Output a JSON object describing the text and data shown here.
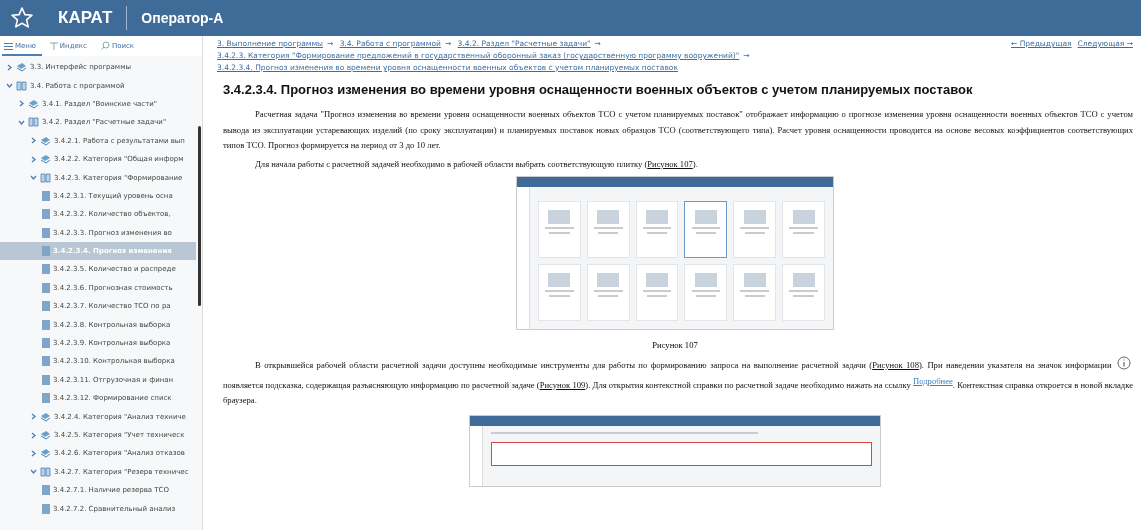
{
  "header": {
    "app_name": "КАРАТ",
    "user": "Оператор-А"
  },
  "sidebar": {
    "tabs": [
      {
        "label": "Меню",
        "kind": "menu",
        "selected": true
      },
      {
        "label": "Индекс",
        "kind": "index",
        "selected": false
      },
      {
        "label": "Поиск",
        "kind": "search",
        "selected": false
      }
    ],
    "tree": [
      {
        "label": "3.3. Интерфейс программы",
        "expanded": false,
        "selected": false,
        "kind": "section"
      },
      {
        "label": "3.4. Работа с программой",
        "expanded": true,
        "selected": false,
        "kind": "section",
        "children": [
          {
            "label": "3.4.1. Раздел \"Воинские части\"",
            "expanded": false,
            "selected": false,
            "kind": "section"
          },
          {
            "label": "3.4.2. Раздел \"Расчетные задачи\"",
            "expanded": true,
            "selected": false,
            "kind": "section",
            "children": [
              {
                "label": "3.4.2.1. Работа с результатами вып",
                "expanded": false,
                "selected": false,
                "kind": "section"
              },
              {
                "label": "3.4.2.2. Категория \"Общая информ",
                "expanded": false,
                "selected": false,
                "kind": "section"
              },
              {
                "label": "3.4.2.3. Категория \"Формирование",
                "expanded": true,
                "selected": false,
                "kind": "section",
                "children": [
                  {
                    "label": "3.4.2.3.1. Текущий уровень осна",
                    "selected": false,
                    "kind": "page"
                  },
                  {
                    "label": "3.4.2.3.2. Количество объектов,",
                    "selected": false,
                    "kind": "page"
                  },
                  {
                    "label": "3.4.2.3.3. Прогноз изменения во",
                    "selected": false,
                    "kind": "page"
                  },
                  {
                    "label": "3.4.2.3.4. Прогноз изменения",
                    "selected": true,
                    "kind": "page"
                  },
                  {
                    "label": "3.4.2.3.5. Количество и распреде",
                    "selected": false,
                    "kind": "page"
                  },
                  {
                    "label": "3.4.2.3.6. Прогнозная стоимость",
                    "selected": false,
                    "kind": "page"
                  },
                  {
                    "label": "3.4.2.3.7. Количество ТСО по ра",
                    "selected": false,
                    "kind": "page"
                  },
                  {
                    "label": "3.4.2.3.8. Контрольная выборка",
                    "selected": false,
                    "kind": "page"
                  },
                  {
                    "label": "3.4.2.3.9. Контрольная выборка",
                    "selected": false,
                    "kind": "page"
                  },
                  {
                    "label": "3.4.2.3.10. Контрольная выборка",
                    "selected": false,
                    "kind": "page"
                  },
                  {
                    "label": "3.4.2.3.11. Отгрузочная и финан",
                    "selected": false,
                    "kind": "page"
                  },
                  {
                    "label": "3.4.2.3.12. Формирование списк",
                    "selected": false,
                    "kind": "page"
                  }
                ]
              },
              {
                "label": "3.4.2.4. Категория \"Анализ техниче",
                "expanded": false,
                "selected": false,
                "kind": "section"
              },
              {
                "label": "3.4.2.5. Категория \"Учет техническ",
                "expanded": false,
                "selected": false,
                "kind": "section"
              },
              {
                "label": "3.4.2.6. Категория \"Анализ отказов",
                "expanded": false,
                "selected": false,
                "kind": "section"
              },
              {
                "label": "3.4.2.7. Категория \"Резерв техничес",
                "expanded": true,
                "selected": false,
                "kind": "section",
                "children": [
                  {
                    "label": "3.4.2.7.1. Наличие резерва ТСО",
                    "selected": false,
                    "kind": "page"
                  },
                  {
                    "label": "3.4.2.7.2. Сравнительный анализ",
                    "selected": false,
                    "kind": "page"
                  }
                ]
              }
            ]
          }
        ]
      }
    ]
  },
  "breadcrumb": {
    "items": [
      "3. Выполнение программы",
      "3.4. Работа с программой",
      "3.4.2. Раздел \"Расчетные задачи\"",
      "3.4.2.3. Категория \"Формирование предложений в государственный оборонный заказ (государственную программу вооружений)\"",
      "3.4.2.3.4. Прогноз изменения во времени уровня оснащенности военных объектов с учетом планируемых поставок"
    ],
    "separator": "→",
    "previous": "← Предыдущая",
    "next": "Следующая →"
  },
  "article": {
    "title": "3.4.2.3.4. Прогноз изменения во времени уровня оснащенности военных объектов с учетом планируемых поставок",
    "blocks": [
      {
        "kind": "paragraph",
        "segments": [
          {
            "kind": "text",
            "text": "Расчетная задача \"Прогноз изменения во времени уровня оснащенности военных объектов ТСО с учетом планируемых поставок\" отображает информацию о прогнозе изменения уровня оснащенности военных объектов ТСО с учетом вывода из эксплуатации устаревающих изделий (по сроку эксплуатации) и планируемых поставок новых образцов ТСО (соответствующего типа). Расчет уровня оснащенности проводится на основе весовых коэффициентов соответствующих типов ТСО. Прогноз формируется на период от 3 до 10 лет."
          }
        ]
      },
      {
        "kind": "paragraph",
        "segments": [
          {
            "kind": "text",
            "text": "Для начала работы с расчетной задачей необходимо в рабочей области выбрать соответствующую плитку ("
          },
          {
            "kind": "link",
            "text": "Рисунок 107"
          },
          {
            "kind": "text",
            "text": ")."
          }
        ]
      },
      {
        "kind": "figure-tiles",
        "caption": "Рисунок 107"
      },
      {
        "kind": "paragraph",
        "segments": [
          {
            "kind": "text",
            "text": "В открывшейся рабочей области расчетной задачи доступны необходимые инструменты для работы по формированию запроса на выполнение расчетной задачи ("
          },
          {
            "kind": "link",
            "text": "Рисунок 108"
          },
          {
            "kind": "text",
            "text": "). При наведении указателя  на значок информации "
          },
          {
            "kind": "info"
          },
          {
            "kind": "text",
            "text": " появляется подсказка, содержащая разъясняющую информацию по расчетной задаче ("
          },
          {
            "kind": "link",
            "text": "Рисунок 109"
          },
          {
            "kind": "text",
            "text": "). Для открытия контекстной справки по расчетной задаче необходимо нажать на ссылку "
          },
          {
            "kind": "help-link",
            "text": "Подробнее"
          },
          {
            "kind": "text",
            "text": ". Контекстная справка откроется в новой вкладке браузера."
          }
        ]
      },
      {
        "kind": "figure-form"
      }
    ]
  }
}
